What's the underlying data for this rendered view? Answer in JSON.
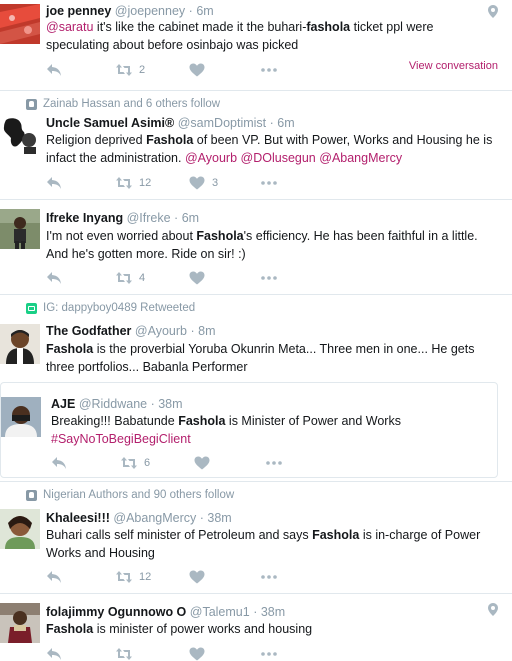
{
  "tweets": [
    {
      "name": "joe penney",
      "handle": "@joepenney",
      "time": "6m",
      "body": [
        {
          "t": "@saratu",
          "c": "mention"
        },
        {
          "t": " it's like the cabinet made it the buhari-"
        },
        {
          "t": "fashola",
          "c": "hl"
        },
        {
          "t": " ticket ppl were speculating about before osinbajo was picked"
        }
      ],
      "reply_label": "Reply",
      "retweets": "2",
      "likes": "",
      "view_conversation": "View conversation",
      "icons": {
        "reply": "reply-icon",
        "retweet": "retweet-icon",
        "like": "heart-icon",
        "more": "more-icon",
        "location": "location-pin-icon"
      }
    },
    {
      "context": "Zainab Hassan and 6 others follow",
      "name": "Uncle Samuel Asimi®",
      "handle": "@samDoptimist",
      "time": "6m",
      "body": [
        {
          "t": "Religion deprived "
        },
        {
          "t": "Fashola",
          "c": "hl"
        },
        {
          "t": " of been VP. But with Power, Works and Housing he is infact the administration. "
        },
        {
          "t": "@Ayourb",
          "c": "mention"
        },
        {
          "t": " "
        },
        {
          "t": "@DOlusegun",
          "c": "mention"
        },
        {
          "t": " "
        },
        {
          "t": "@AbangMercy",
          "c": "mention"
        }
      ],
      "retweets": "12",
      "likes": "3"
    },
    {
      "name": "Ifreke Inyang",
      "handle": "@Ifreke",
      "time": "6m",
      "body": [
        {
          "t": "I'm not even worried about "
        },
        {
          "t": "Fashola",
          "c": "hl"
        },
        {
          "t": "'s efficiency. He has been faithful in a little. And he's gotten more. Ride on sir! :)"
        }
      ],
      "retweets": "4",
      "likes": ""
    },
    {
      "context": "IG: dappyboy0489 Retweeted",
      "name": "The Godfather",
      "handle": "@Ayourb",
      "time": "8m",
      "body": [
        {
          "t": "Fashola",
          "c": "hl"
        },
        {
          "t": " is the proverbial Yoruba Okunrin Meta... Three men in one... He gets three portfolios... Babanla Performer"
        }
      ]
    },
    {
      "name": "AJE",
      "handle": "@Riddwane",
      "time": "38m",
      "body": [
        {
          "t": "Breaking!!! Babatunde "
        },
        {
          "t": "Fashola",
          "c": "hl"
        },
        {
          "t": " is Minister of Power and Works "
        },
        {
          "t": "#SayNoToBegiBegiClient",
          "c": "mention"
        }
      ],
      "retweets": "6",
      "likes": ""
    },
    {
      "context": "Nigerian Authors and 90 others follow",
      "name": "Khaleesi!!!",
      "handle": "@AbangMercy",
      "time": "38m",
      "body": [
        {
          "t": "Buhari calls self minister of Petroleum and says "
        },
        {
          "t": "Fashola",
          "c": "hl"
        },
        {
          "t": " is in-charge of Power Works and Housing"
        }
      ],
      "retweets": "12",
      "likes": ""
    },
    {
      "name": "folajimmy Ogunnowo O",
      "handle": "@Talemu1",
      "time": "38m",
      "body": [
        {
          "t": "Fashola",
          "c": "hl"
        },
        {
          "t": " is minister of power works and housing"
        }
      ],
      "retweets": "",
      "likes": ""
    }
  ],
  "separator": "·",
  "colors": {
    "accent": "#b3206d",
    "muted": "#8899a6",
    "text": "#14171a",
    "border": "#e1e8ed",
    "retweet_green": "#19cf86"
  }
}
